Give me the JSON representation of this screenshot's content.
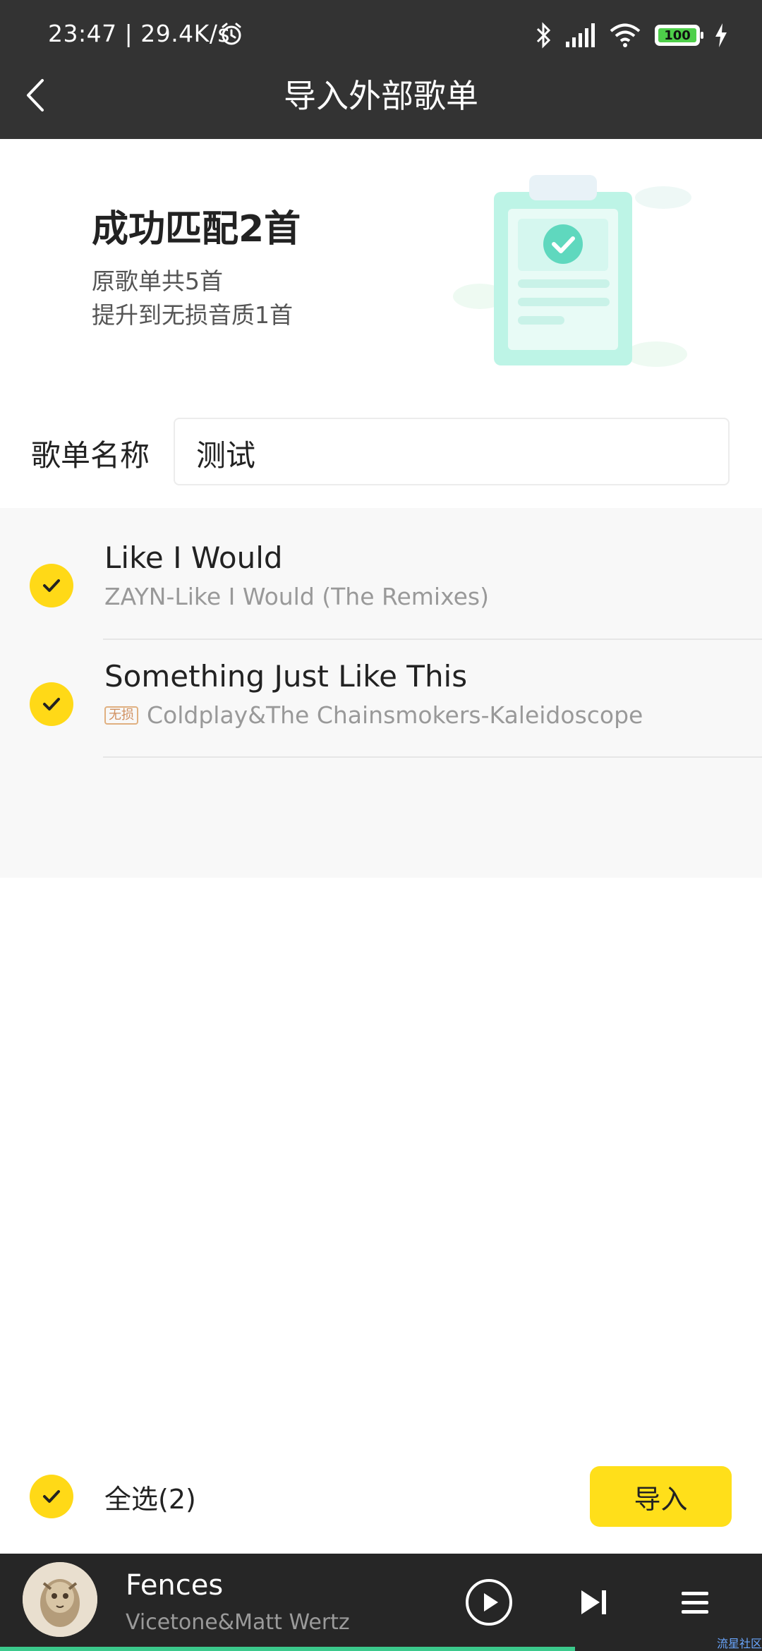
{
  "status_bar": {
    "time_speed": "23:47 | 29.4K/s",
    "battery": "100"
  },
  "header": {
    "title": "导入外部歌单"
  },
  "summary": {
    "title": "成功匹配2首",
    "line1": "原歌单共5首",
    "line2": "提升到无损音质1首"
  },
  "playlist_name": {
    "label": "歌单名称",
    "value": "测试"
  },
  "songs": [
    {
      "title": "Like I Would",
      "subtitle": "ZAYN-Like I Would (The Remixes)",
      "tag": ""
    },
    {
      "title": "Something Just Like This",
      "subtitle": "Coldplay&The Chainsmokers-Kaleidoscope",
      "tag": "无损"
    }
  ],
  "footer": {
    "select_all": "全选(2)",
    "import": "导入"
  },
  "player": {
    "title": "Fences",
    "artist": "Vicetone&Matt Wertz",
    "progress": 0.755
  },
  "watermark": "流星社区",
  "colors": {
    "accent": "#ffd917",
    "topbar": "#333333",
    "progress": "#3bc98c"
  }
}
